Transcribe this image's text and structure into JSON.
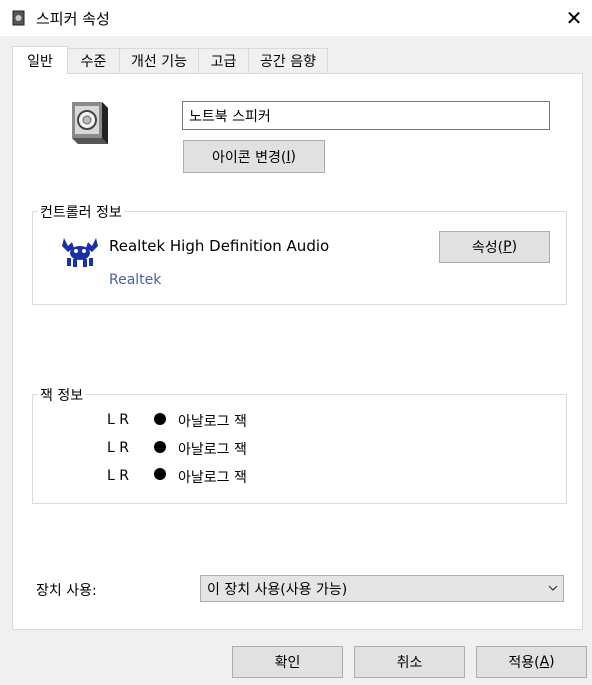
{
  "window": {
    "title": "스피커 속성",
    "close_label": "✕"
  },
  "tabs": [
    "일반",
    "수준",
    "개선 기능",
    "고급",
    "공간 음향"
  ],
  "general": {
    "device_name": "노트북 스피커",
    "change_icon": {
      "label": "아이콘 변경(",
      "mnemonic": "I",
      "suffix": ")"
    }
  },
  "controller": {
    "legend": "컨트롤러 정보",
    "name": "Realtek High Definition Audio",
    "vendor": "Realtek",
    "properties": {
      "label": "속성(",
      "mnemonic": "P",
      "suffix": ")"
    }
  },
  "jacks": {
    "legend": "잭 정보",
    "rows": [
      {
        "channels": "L R",
        "label": "아날로그 잭"
      },
      {
        "channels": "L R",
        "label": "아날로그 잭"
      },
      {
        "channels": "L R",
        "label": "아날로그 잭"
      }
    ]
  },
  "usage": {
    "label": "장치 사용:",
    "selected": "이 장치 사용(사용 가능)"
  },
  "footer": {
    "ok": "확인",
    "cancel": "취소",
    "apply": {
      "label": "적용(",
      "mnemonic": "A",
      "suffix": ")"
    }
  },
  "colors": {
    "vendor_link": "#4a5fa5",
    "accent": "#0078d7"
  }
}
